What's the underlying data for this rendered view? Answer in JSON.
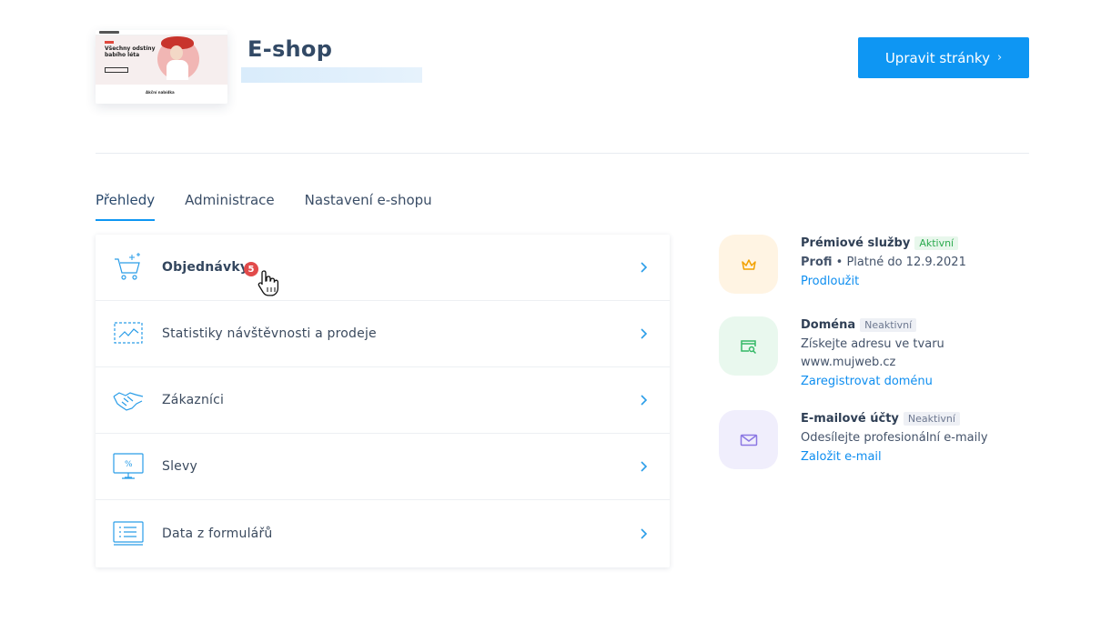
{
  "header": {
    "title": "E-shop",
    "edit_button": "Upravit stránky",
    "thumbnail": {
      "headline": "Všechny odstíny babího léta",
      "subheading": "Akční nabídka"
    }
  },
  "tabs": [
    {
      "label": "Přehledy",
      "active": true
    },
    {
      "label": "Administrace",
      "active": false
    },
    {
      "label": "Nastavení e-shopu",
      "active": false
    }
  ],
  "list": {
    "items": [
      {
        "label": "Objednávky",
        "icon": "cart-icon",
        "badge": "5"
      },
      {
        "label": "Statistiky návštěvnosti a prodeje",
        "icon": "chart-icon"
      },
      {
        "label": "Zákazníci",
        "icon": "handshake-icon"
      },
      {
        "label": "Slevy",
        "icon": "discount-monitor-icon"
      },
      {
        "label": "Data z formulářů",
        "icon": "form-data-icon"
      }
    ]
  },
  "services": [
    {
      "title": "Prémiové služby",
      "status": "Aktivní",
      "plan": "Profi",
      "desc": "Platné do 12.9.2021",
      "link": "Prodloužit",
      "icon": "crown-icon"
    },
    {
      "title": "Doména",
      "status": "Neaktivní",
      "desc_line1": "Získejte adresu ve tvaru",
      "desc_line2": "www.mujweb.cz",
      "link": "Zaregistrovat doménu",
      "icon": "domain-search-icon"
    },
    {
      "title": "E-mailové účty",
      "status": "Neaktivní",
      "desc": "Odesílejte profesionální e-maily",
      "link": "Založit e-mail",
      "icon": "envelope-icon"
    }
  ],
  "colors": {
    "accent": "#0e96f3",
    "badge": "#e14a4a",
    "active_status": "#2cab4f"
  }
}
